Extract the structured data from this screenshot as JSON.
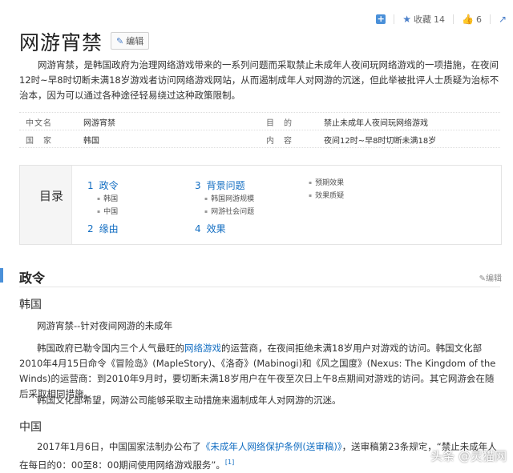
{
  "toolbar": {
    "collect_label": "收藏",
    "collect_count": "14",
    "like_count": "6"
  },
  "title": "网游宵禁",
  "edit_label": "编辑",
  "summary": "网游宵禁，是韩国政府为治理网络游戏带来的一系列问题而采取禁止未成年人夜间玩网络游戏的一项措施，在夜间12时~早8时切断未满18岁游戏者访问网络游戏网站，从而遏制成年人对网游的沉迷，但此举被批评人士质疑为治标不治本，因为可以通过各种途径轻易绕过这种政策限制。",
  "infobox": {
    "rows": [
      {
        "k1": "中文名",
        "v1": "网游宵禁",
        "k2": "目　的",
        "v2": "禁止未成年人夜间玩网络游戏"
      },
      {
        "k1": "国　家",
        "v1": "韩国",
        "k2": "内　容",
        "v2": "夜间12时~早8时切断未满18岁"
      }
    ]
  },
  "toc": {
    "label": "目录",
    "items": [
      {
        "num": "1",
        "label": "政令",
        "subs": [
          "韩国",
          "中国"
        ]
      },
      {
        "num": "2",
        "label": "缘由"
      },
      {
        "num": "3",
        "label": "背景问题",
        "subs": [
          "韩国网游规模",
          "网游社会问题"
        ]
      },
      {
        "num": "4",
        "label": "效果"
      }
    ],
    "extra_subs": [
      "预期效果",
      "效果质疑"
    ]
  },
  "section": {
    "title": "政令",
    "edit_label": "编辑",
    "korea_title": "韩国",
    "korea_p1": "网游宵禁--针对夜间网游的未成年",
    "korea_p2_pre": "韩国政府已勒令国内三个人气最旺的",
    "korea_p2_link": "网络游戏",
    "korea_p2_post": "的运营商，在夜间拒绝未满18岁用户对游戏的访问。韩国文化部2010年4月15日命令《冒险岛》(MapleStory)、《洛奇》(Mabinogi)和《风之国度》(Nexus: The Kingdom of the Winds)的运营商：到2010年9月时，要切断未满18岁用户在午夜至次日上午8点期间对游戏的访问。其它网游会在随后采取相同措施。",
    "korea_p3": "韩国文化部希望，网游公司能够采取主动措施来遏制成年人对网游的沉迷。",
    "china_title": "中国",
    "china_p1_pre": "2017年1月6日，中国国家法制办公布了",
    "china_p1_link": "《未成年人网络保护条例(送审稿)》",
    "china_p1_post": "，送审稿第23条规定，“禁止未成年人在每日的0：00至8：00期间使用网络游戏服务”。",
    "china_ref": "[1]"
  },
  "watermark": "头条 @灵猫网"
}
